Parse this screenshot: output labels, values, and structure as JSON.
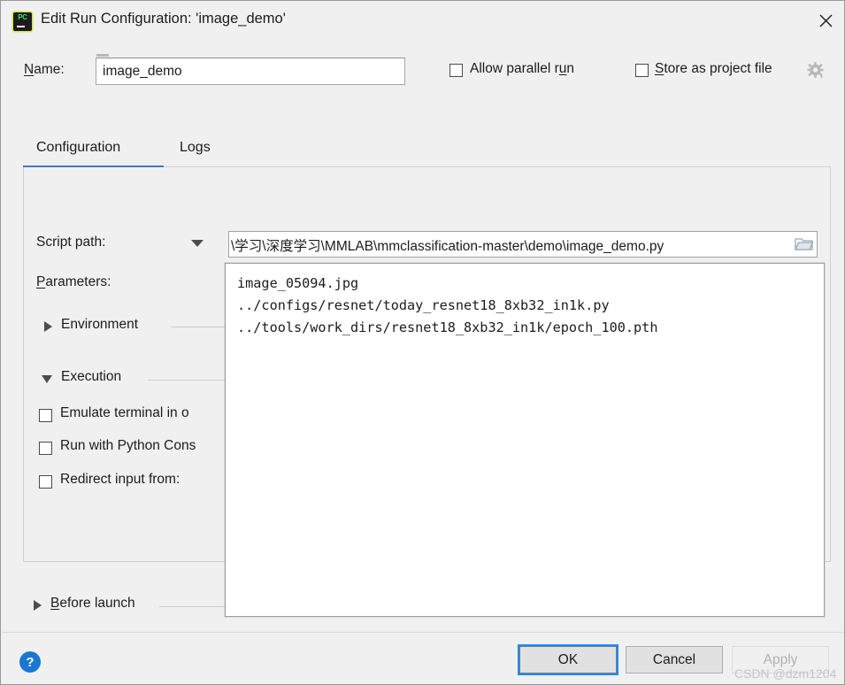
{
  "window": {
    "title": "Edit Run Configuration: 'image_demo'",
    "app_icon": "pycharm-icon",
    "close_icon": "close-icon"
  },
  "name_row": {
    "label": "Name:",
    "label_mnemonic": "N",
    "value": "image_demo",
    "placeholder": ""
  },
  "options": {
    "allow_parallel_run": {
      "label_before": "Allow parallel r",
      "mnemonic": "u",
      "label_after": "n",
      "checked": false
    },
    "store_as_project_file": {
      "mnemonic": "S",
      "label_after": "tore as project file",
      "checked": false
    },
    "gear_icon": "gear-icon"
  },
  "tabs": [
    {
      "label": "Configuration",
      "active": true
    },
    {
      "label": "Logs",
      "active": false
    }
  ],
  "configuration": {
    "script_path": {
      "label": "Script path:",
      "value": "\\学习\\深度学习\\MMLAB\\mmclassification-master\\demo\\image_demo.py",
      "browse_icon": "folder-icon",
      "dropdown_icon": "chevron-down-icon"
    },
    "parameters": {
      "label": "Parameters:",
      "label_mnemonic": "P"
    },
    "sections": [
      {
        "name": "environment",
        "label": "Environment",
        "expanded": false
      },
      {
        "name": "execution",
        "label": "Execution",
        "expanded": true
      }
    ],
    "execution_options": [
      {
        "name": "emulate-terminal",
        "label": "Emulate terminal in o",
        "checked": false
      },
      {
        "name": "run-with-python-console",
        "label": "Run with Python Cons",
        "checked": false
      },
      {
        "name": "redirect-input-from",
        "label": "Redirect input from:",
        "checked": false
      }
    ]
  },
  "before_launch": {
    "mnemonic": "B",
    "label_after": "efore launch",
    "expanded": false
  },
  "parameters_popup": {
    "lines": "image_05094.jpg\n../configs/resnet/today_resnet18_8xb32_in1k.py\n../tools/work_dirs/resnet18_8xb32_in1k/epoch_100.pth"
  },
  "footer": {
    "help_label": "?",
    "ok_label": "OK",
    "cancel_label": "Cancel",
    "apply_label": "Apply",
    "apply_enabled": false
  },
  "watermark": "CSDN @dzm1204",
  "colors": {
    "dialog_bg": "#f0f0f0",
    "accent_blue": "#3f7cbf",
    "focus_blue": "#1a8cff",
    "help_blue": "#1a77d2",
    "text": "#1c1c1c",
    "disabled_text": "#b0b0b0"
  }
}
